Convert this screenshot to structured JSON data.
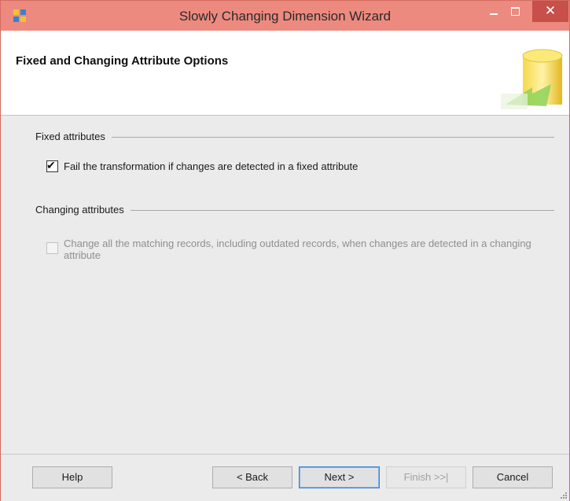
{
  "window": {
    "title": "Slowly Changing Dimension Wizard",
    "close_glyph": "✕",
    "icons": {
      "app": "sql-wizard-icon",
      "minimize": "minimize-icon",
      "maximize": "maximize-icon",
      "close": "close-icon"
    }
  },
  "header": {
    "title": "Fixed and Changing Attribute Options",
    "graphic": "database-wizard-graphic"
  },
  "fixed": {
    "group_label": "Fixed attributes",
    "checkbox_label": "Fail the transformation if changes are detected in a fixed attribute",
    "checked": true
  },
  "changing": {
    "group_label": "Changing attributes",
    "checkbox_label": "Change all the matching records, including outdated records, when changes are detected in a changing attribute",
    "checked": false,
    "enabled": false
  },
  "buttons": {
    "help": "Help",
    "back": "< Back",
    "next": "Next >",
    "finish": "Finish >>|",
    "cancel": "Cancel"
  },
  "colors": {
    "titlebar": "#ed8a7f",
    "close_button": "#c7504a",
    "dialog_background": "#ebebeb",
    "default_button_border": "#3c84d6"
  }
}
